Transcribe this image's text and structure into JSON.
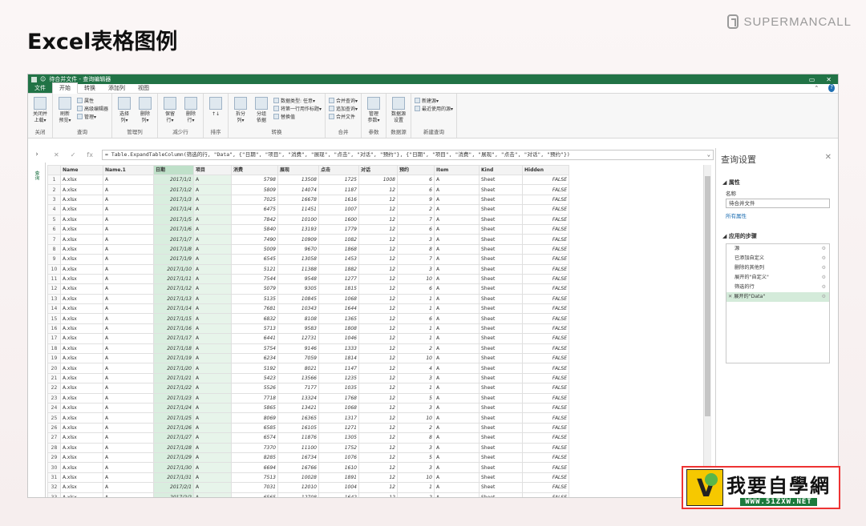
{
  "page": {
    "title": "Excel表格图例",
    "brand": "SUPERMANCALL"
  },
  "window": {
    "title": "待合并文件 - 查询编辑器",
    "controls": [
      "▭",
      "✕"
    ]
  },
  "menu": {
    "file": "文件",
    "tabs": [
      "开始",
      "转换",
      "添加列",
      "视图"
    ],
    "active_index": 0,
    "right": [
      "⌃",
      "?"
    ]
  },
  "ribbon": {
    "groups": [
      {
        "label": "关闭",
        "big": [
          "关闭并\n上载▾"
        ],
        "small": []
      },
      {
        "label": "查询",
        "big": [
          "刷新\n预览▾"
        ],
        "small": [
          "属性",
          "高级编辑器",
          "管理▾"
        ]
      },
      {
        "label": "管理列",
        "big": [
          "选择\n列▾",
          "删除\n列▾"
        ],
        "small": []
      },
      {
        "label": "减少行",
        "big": [
          "保留\n行▾",
          "删除\n行▾"
        ],
        "small": []
      },
      {
        "label": "排序",
        "big": [
          "↑↓"
        ],
        "small": []
      },
      {
        "label": "转换",
        "big": [
          "拆分\n列▾",
          "分组\n依据"
        ],
        "small": [
          "数据类型: 任意▾",
          "将第一行用作标题▾",
          "替换值"
        ]
      },
      {
        "label": "合并",
        "big": [],
        "small": [
          "合并查询▾",
          "追加查询▾",
          "合并文件"
        ]
      },
      {
        "label": "参数",
        "big": [
          "管理\n参数▾"
        ],
        "small": []
      },
      {
        "label": "数据源",
        "big": [
          "数据源\n设置"
        ],
        "small": []
      },
      {
        "label": "新建查询",
        "big": [],
        "small": [
          "新建源▾",
          "最近使用的源▾"
        ]
      }
    ]
  },
  "formula": {
    "expand": "›",
    "cancel": "✕",
    "confirm": "✓",
    "fx": "fx",
    "text": "= Table.ExpandTableColumn(筛选的行, \"Data\", {\"日期\", \"项目\", \"消费\", \"展现\", \"点击\", \"对话\", \"预约\"}, {\"日期\", \"项目\", \"消费\", \"展现\", \"点击\", \"对话\", \"预约\"})",
    "chevron": "⌄"
  },
  "left_tab": "查询",
  "table": {
    "headers": [
      "Name",
      "Name.1",
      "日期",
      "项目",
      "消费",
      "展现",
      "点击",
      "对话",
      "预约",
      "Item",
      "Kind",
      "Hidden"
    ],
    "rows": [
      [
        "1",
        "A.xlsx",
        "A",
        "2017/1/1",
        "A",
        "5798",
        "13508",
        "1725",
        "1008",
        "6",
        "A",
        "Sheet",
        "FALSE"
      ],
      [
        "2",
        "A.xlsx",
        "A",
        "2017/1/2",
        "A",
        "5809",
        "14074",
        "1187",
        "12",
        "6",
        "A",
        "Sheet",
        "FALSE"
      ],
      [
        "3",
        "A.xlsx",
        "A",
        "2017/1/3",
        "A",
        "7025",
        "16678",
        "1616",
        "12",
        "9",
        "A",
        "Sheet",
        "FALSE"
      ],
      [
        "4",
        "A.xlsx",
        "A",
        "2017/1/4",
        "A",
        "6475",
        "11451",
        "1007",
        "12",
        "2",
        "A",
        "Sheet",
        "FALSE"
      ],
      [
        "5",
        "A.xlsx",
        "A",
        "2017/1/5",
        "A",
        "7842",
        "10100",
        "1600",
        "12",
        "7",
        "A",
        "Sheet",
        "FALSE"
      ],
      [
        "6",
        "A.xlsx",
        "A",
        "2017/1/6",
        "A",
        "5840",
        "13193",
        "1779",
        "12",
        "6",
        "A",
        "Sheet",
        "FALSE"
      ],
      [
        "7",
        "A.xlsx",
        "A",
        "2017/1/7",
        "A",
        "7490",
        "10909",
        "1082",
        "12",
        "3",
        "A",
        "Sheet",
        "FALSE"
      ],
      [
        "8",
        "A.xlsx",
        "A",
        "2017/1/8",
        "A",
        "5009",
        "9670",
        "1868",
        "12",
        "8",
        "A",
        "Sheet",
        "FALSE"
      ],
      [
        "9",
        "A.xlsx",
        "A",
        "2017/1/9",
        "A",
        "6545",
        "13058",
        "1453",
        "12",
        "7",
        "A",
        "Sheet",
        "FALSE"
      ],
      [
        "10",
        "A.xlsx",
        "A",
        "2017/1/10",
        "A",
        "5121",
        "11388",
        "1882",
        "12",
        "3",
        "A",
        "Sheet",
        "FALSE"
      ],
      [
        "11",
        "A.xlsx",
        "A",
        "2017/1/11",
        "A",
        "7544",
        "9548",
        "1277",
        "12",
        "10",
        "A",
        "Sheet",
        "FALSE"
      ],
      [
        "12",
        "A.xlsx",
        "A",
        "2017/1/12",
        "A",
        "5079",
        "9305",
        "1815",
        "12",
        "6",
        "A",
        "Sheet",
        "FALSE"
      ],
      [
        "13",
        "A.xlsx",
        "A",
        "2017/1/13",
        "A",
        "5135",
        "10845",
        "1068",
        "12",
        "1",
        "A",
        "Sheet",
        "FALSE"
      ],
      [
        "14",
        "A.xlsx",
        "A",
        "2017/1/14",
        "A",
        "7681",
        "10343",
        "1644",
        "12",
        "1",
        "A",
        "Sheet",
        "FALSE"
      ],
      [
        "15",
        "A.xlsx",
        "A",
        "2017/1/15",
        "A",
        "6832",
        "8108",
        "1365",
        "12",
        "6",
        "A",
        "Sheet",
        "FALSE"
      ],
      [
        "16",
        "A.xlsx",
        "A",
        "2017/1/16",
        "A",
        "5713",
        "9583",
        "1808",
        "12",
        "1",
        "A",
        "Sheet",
        "FALSE"
      ],
      [
        "17",
        "A.xlsx",
        "A",
        "2017/1/17",
        "A",
        "6441",
        "12731",
        "1046",
        "12",
        "1",
        "A",
        "Sheet",
        "FALSE"
      ],
      [
        "18",
        "A.xlsx",
        "A",
        "2017/1/18",
        "A",
        "5754",
        "9146",
        "1333",
        "12",
        "2",
        "A",
        "Sheet",
        "FALSE"
      ],
      [
        "19",
        "A.xlsx",
        "A",
        "2017/1/19",
        "A",
        "6234",
        "7059",
        "1814",
        "12",
        "10",
        "A",
        "Sheet",
        "FALSE"
      ],
      [
        "20",
        "A.xlsx",
        "A",
        "2017/1/20",
        "A",
        "5192",
        "8021",
        "1147",
        "12",
        "4",
        "A",
        "Sheet",
        "FALSE"
      ],
      [
        "21",
        "A.xlsx",
        "A",
        "2017/1/21",
        "A",
        "5423",
        "13566",
        "1235",
        "12",
        "3",
        "A",
        "Sheet",
        "FALSE"
      ],
      [
        "22",
        "A.xlsx",
        "A",
        "2017/1/22",
        "A",
        "5526",
        "7177",
        "1035",
        "12",
        "1",
        "A",
        "Sheet",
        "FALSE"
      ],
      [
        "23",
        "A.xlsx",
        "A",
        "2017/1/23",
        "A",
        "7718",
        "13324",
        "1768",
        "12",
        "5",
        "A",
        "Sheet",
        "FALSE"
      ],
      [
        "24",
        "A.xlsx",
        "A",
        "2017/1/24",
        "A",
        "5865",
        "13421",
        "1068",
        "12",
        "3",
        "A",
        "Sheet",
        "FALSE"
      ],
      [
        "25",
        "A.xlsx",
        "A",
        "2017/1/25",
        "A",
        "8069",
        "16365",
        "1317",
        "12",
        "10",
        "A",
        "Sheet",
        "FALSE"
      ],
      [
        "26",
        "A.xlsx",
        "A",
        "2017/1/26",
        "A",
        "6585",
        "16105",
        "1271",
        "12",
        "2",
        "A",
        "Sheet",
        "FALSE"
      ],
      [
        "27",
        "A.xlsx",
        "A",
        "2017/1/27",
        "A",
        "6574",
        "11876",
        "1305",
        "12",
        "8",
        "A",
        "Sheet",
        "FALSE"
      ],
      [
        "28",
        "A.xlsx",
        "A",
        "2017/1/28",
        "A",
        "7370",
        "11100",
        "1752",
        "12",
        "3",
        "A",
        "Sheet",
        "FALSE"
      ],
      [
        "29",
        "A.xlsx",
        "A",
        "2017/1/29",
        "A",
        "8285",
        "16734",
        "1076",
        "12",
        "5",
        "A",
        "Sheet",
        "FALSE"
      ],
      [
        "30",
        "A.xlsx",
        "A",
        "2017/1/30",
        "A",
        "6694",
        "16766",
        "1610",
        "12",
        "3",
        "A",
        "Sheet",
        "FALSE"
      ],
      [
        "31",
        "A.xlsx",
        "A",
        "2017/1/31",
        "A",
        "7513",
        "10028",
        "1891",
        "12",
        "10",
        "A",
        "Sheet",
        "FALSE"
      ],
      [
        "32",
        "A.xlsx",
        "A",
        "2017/2/1",
        "A",
        "7031",
        "12010",
        "1004",
        "12",
        "1",
        "A",
        "Sheet",
        "FALSE"
      ],
      [
        "33",
        "A.xlsx",
        "A",
        "2017/2/2",
        "A",
        "6565",
        "12708",
        "1642",
        "12",
        "2",
        "A",
        "Sheet",
        "FALSE"
      ]
    ]
  },
  "pane": {
    "title": "查询设置",
    "close": "✕",
    "props_heading": "◢ 属性",
    "name_label": "名称",
    "name_value": "待合并文件",
    "all_props": "所有属性",
    "steps_heading": "◢ 应用的步骤",
    "steps": [
      "源",
      "已添加自定义",
      "删除的其他列",
      "展开的\"自定义\"",
      "筛选的行",
      "展开的\"Data\""
    ],
    "selected_step": 5,
    "step_x": "✕",
    "gear": "⚙"
  },
  "watermark": {
    "cn": "我要自學網",
    "url": "WWW.51ZXW.NET"
  },
  "colors": {
    "excel_green": "#217346",
    "selected_column": "#d9eedf"
  }
}
